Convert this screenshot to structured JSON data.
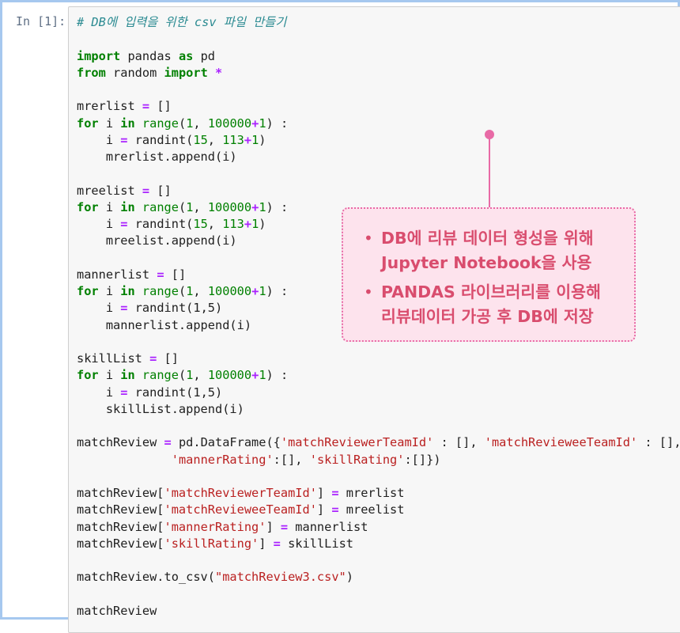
{
  "notebook": {
    "prompt": "In [1]:",
    "code_lines": [
      [
        [
          "comment",
          "# DB에 입력을 위한 csv 파일 만들기"
        ]
      ],
      [],
      [
        [
          "keyword",
          "import"
        ],
        [
          "plain",
          " pandas "
        ],
        [
          "keyword",
          "as"
        ],
        [
          "plain",
          " pd"
        ]
      ],
      [
        [
          "keyword",
          "from"
        ],
        [
          "plain",
          " random "
        ],
        [
          "keyword",
          "import"
        ],
        [
          "plain",
          " "
        ],
        [
          "operator",
          "*"
        ]
      ],
      [],
      [
        [
          "plain",
          "mrerlist "
        ],
        [
          "operator",
          "="
        ],
        [
          "plain",
          " []"
        ]
      ],
      [
        [
          "keyword",
          "for"
        ],
        [
          "plain",
          " i "
        ],
        [
          "keyword",
          "in"
        ],
        [
          "plain",
          " "
        ],
        [
          "builtin",
          "range"
        ],
        [
          "plain",
          "("
        ],
        [
          "number",
          "1"
        ],
        [
          "plain",
          ", "
        ],
        [
          "number",
          "100000"
        ],
        [
          "operator",
          "+"
        ],
        [
          "number",
          "1"
        ],
        [
          "plain",
          ") :"
        ]
      ],
      [
        [
          "plain",
          "    i "
        ],
        [
          "operator",
          "="
        ],
        [
          "plain",
          " randint("
        ],
        [
          "number",
          "15"
        ],
        [
          "plain",
          ", "
        ],
        [
          "number",
          "113"
        ],
        [
          "operator",
          "+"
        ],
        [
          "number",
          "1"
        ],
        [
          "plain",
          ")"
        ]
      ],
      [
        [
          "plain",
          "    mrerlist.append(i)"
        ]
      ],
      [],
      [
        [
          "plain",
          "mreelist "
        ],
        [
          "operator",
          "="
        ],
        [
          "plain",
          " []"
        ]
      ],
      [
        [
          "keyword",
          "for"
        ],
        [
          "plain",
          " i "
        ],
        [
          "keyword",
          "in"
        ],
        [
          "plain",
          " "
        ],
        [
          "builtin",
          "range"
        ],
        [
          "plain",
          "("
        ],
        [
          "number",
          "1"
        ],
        [
          "plain",
          ", "
        ],
        [
          "number",
          "100000"
        ],
        [
          "operator",
          "+"
        ],
        [
          "number",
          "1"
        ],
        [
          "plain",
          ") :"
        ]
      ],
      [
        [
          "plain",
          "    i "
        ],
        [
          "operator",
          "="
        ],
        [
          "plain",
          " randint("
        ],
        [
          "number",
          "15"
        ],
        [
          "plain",
          ", "
        ],
        [
          "number",
          "113"
        ],
        [
          "operator",
          "+"
        ],
        [
          "number",
          "1"
        ],
        [
          "plain",
          ")"
        ]
      ],
      [
        [
          "plain",
          "    mreelist.append(i)"
        ]
      ],
      [],
      [
        [
          "plain",
          "mannerlist "
        ],
        [
          "operator",
          "="
        ],
        [
          "plain",
          " []"
        ]
      ],
      [
        [
          "keyword",
          "for"
        ],
        [
          "plain",
          " i "
        ],
        [
          "keyword",
          "in"
        ],
        [
          "plain",
          " "
        ],
        [
          "builtin",
          "range"
        ],
        [
          "plain",
          "("
        ],
        [
          "number",
          "1"
        ],
        [
          "plain",
          ", "
        ],
        [
          "number",
          "100000"
        ],
        [
          "operator",
          "+"
        ],
        [
          "number",
          "1"
        ],
        [
          "plain",
          ") :"
        ]
      ],
      [
        [
          "plain",
          "    i "
        ],
        [
          "operator",
          "="
        ],
        [
          "plain",
          " randint(1,5)"
        ]
      ],
      [
        [
          "plain",
          "    mannerlist.append(i)"
        ]
      ],
      [],
      [
        [
          "plain",
          "skillList "
        ],
        [
          "operator",
          "="
        ],
        [
          "plain",
          " []"
        ]
      ],
      [
        [
          "keyword",
          "for"
        ],
        [
          "plain",
          " i "
        ],
        [
          "keyword",
          "in"
        ],
        [
          "plain",
          " "
        ],
        [
          "builtin",
          "range"
        ],
        [
          "plain",
          "("
        ],
        [
          "number",
          "1"
        ],
        [
          "plain",
          ", "
        ],
        [
          "number",
          "100000"
        ],
        [
          "operator",
          "+"
        ],
        [
          "number",
          "1"
        ],
        [
          "plain",
          ") :"
        ]
      ],
      [
        [
          "plain",
          "    i "
        ],
        [
          "operator",
          "="
        ],
        [
          "plain",
          " randint(1,5)"
        ]
      ],
      [
        [
          "plain",
          "    skillList.append(i)"
        ]
      ],
      [],
      [
        [
          "plain",
          "matchReview "
        ],
        [
          "operator",
          "="
        ],
        [
          "plain",
          " pd.DataFrame({"
        ],
        [
          "string",
          "'matchReviewerTeamId'"
        ],
        [
          "plain",
          " : [], "
        ],
        [
          "string",
          "'matchRevieweeTeamId'"
        ],
        [
          "plain",
          " : [],"
        ]
      ],
      [
        [
          "plain",
          "             "
        ],
        [
          "string",
          "'mannerRating'"
        ],
        [
          "plain",
          ":[], "
        ],
        [
          "string",
          "'skillRating'"
        ],
        [
          "plain",
          ":[]})"
        ]
      ],
      [],
      [
        [
          "plain",
          "matchReview["
        ],
        [
          "string",
          "'matchReviewerTeamId'"
        ],
        [
          "plain",
          "] "
        ],
        [
          "operator",
          "="
        ],
        [
          "plain",
          " mrerlist"
        ]
      ],
      [
        [
          "plain",
          "matchReview["
        ],
        [
          "string",
          "'matchRevieweeTeamId'"
        ],
        [
          "plain",
          "] "
        ],
        [
          "operator",
          "="
        ],
        [
          "plain",
          " mreelist"
        ]
      ],
      [
        [
          "plain",
          "matchReview["
        ],
        [
          "string",
          "'mannerRating'"
        ],
        [
          "plain",
          "] "
        ],
        [
          "operator",
          "="
        ],
        [
          "plain",
          " mannerlist"
        ]
      ],
      [
        [
          "plain",
          "matchReview["
        ],
        [
          "string",
          "'skillRating'"
        ],
        [
          "plain",
          "] "
        ],
        [
          "operator",
          "="
        ],
        [
          "plain",
          " skillList"
        ]
      ],
      [],
      [
        [
          "plain",
          "matchReview.to_csv("
        ],
        [
          "string",
          "\"matchReview3.csv\""
        ],
        [
          "plain",
          ")"
        ]
      ],
      [],
      [
        [
          "plain",
          "matchReview"
        ]
      ]
    ]
  },
  "callout": {
    "bullets": [
      "DB에 리뷰 데이터 형성을 위해\nJupyter Notebook을 사용",
      "PANDAS 라이브러리를 이용해\n리뷰데이터 가공 후 DB에 저장"
    ],
    "colors": {
      "text": "#d94d6e",
      "background": "#fde3ed",
      "border": "#e86aa6"
    }
  },
  "colors": {
    "frame_border": "#a6c8ef",
    "cell_background": "#f7f7f7",
    "keyword": "#008000",
    "string": "#ba2121",
    "comment": "#2a8a91",
    "operator": "#aa22ff"
  }
}
